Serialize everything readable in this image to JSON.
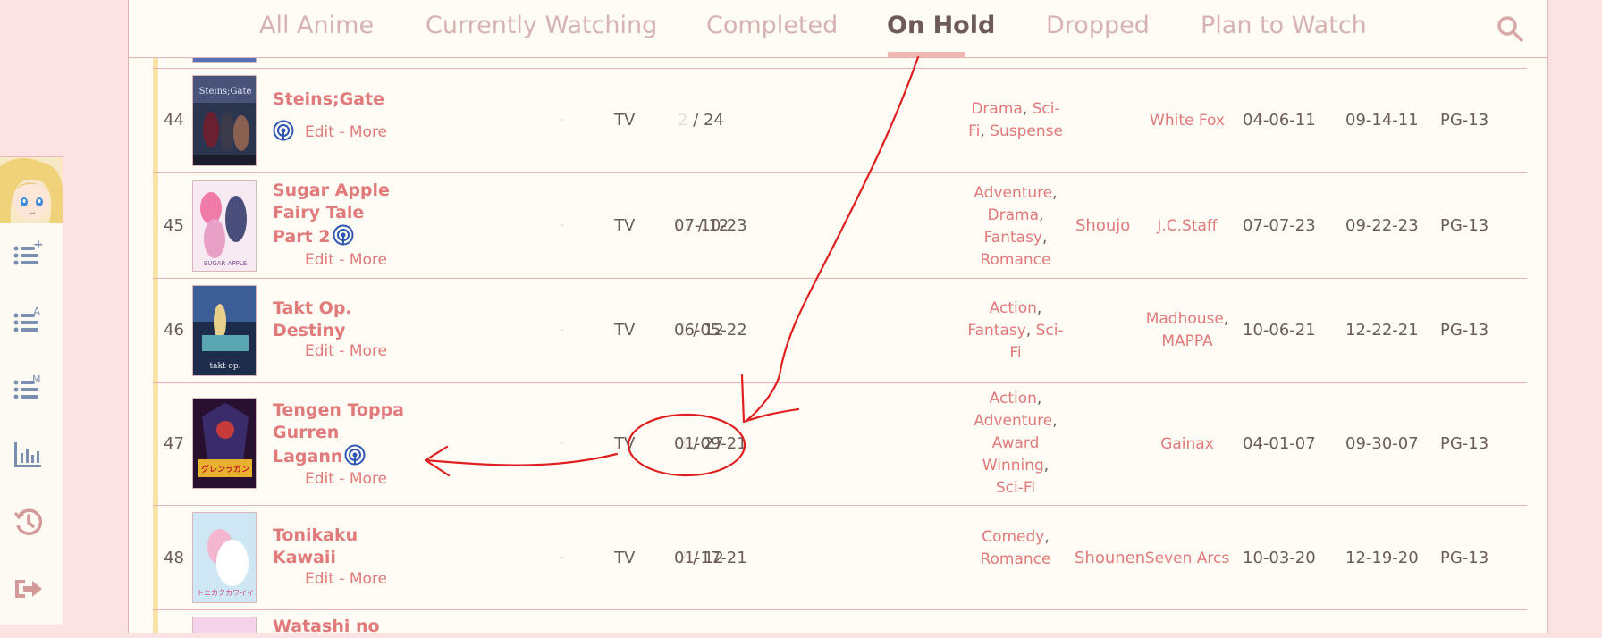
{
  "tabs": [
    {
      "label": "All Anime",
      "active": false
    },
    {
      "label": "Currently Watching",
      "active": false
    },
    {
      "label": "Completed",
      "active": false
    },
    {
      "label": "On Hold",
      "active": true
    },
    {
      "label": "Dropped",
      "active": false
    },
    {
      "label": "Plan to Watch",
      "active": false
    }
  ],
  "sidebar": {
    "icons": [
      "add-list-icon",
      "list-alpha-icon",
      "list-manga-icon",
      "stats-icon",
      "history-icon",
      "logout-icon"
    ],
    "superscripts": [
      "+",
      "A",
      "M"
    ]
  },
  "edit_more": {
    "edit": "Edit",
    "sep": "-",
    "more": "More"
  },
  "rows": [
    {
      "num": "44",
      "title": "Steins;Gate",
      "score": "-",
      "type": "TV",
      "watched": "2",
      "total": "/ 24",
      "start_date": "",
      "genres": [
        "Drama",
        "Sci-Fi",
        "Suspense"
      ],
      "demographic": "",
      "studios": [
        "White Fox"
      ],
      "aired_start": "04-06-11",
      "aired_end": "09-14-11",
      "rating": "PG-13"
    },
    {
      "num": "45",
      "title": "Sugar Apple Fairy Tale Part 2",
      "score": "-",
      "type": "TV",
      "watched": "11",
      "total": "/ 12",
      "start_date": "07-10-23",
      "genres": [
        "Adventure",
        "Drama",
        "Fantasy",
        "Romance"
      ],
      "demographic": "Shoujo",
      "studios": [
        "J.C.Staff"
      ],
      "aired_start": "07-07-23",
      "aired_end": "09-22-23",
      "rating": "PG-13"
    },
    {
      "num": "46",
      "title": "Takt Op. Destiny",
      "score": "-",
      "type": "TV",
      "watched": "1",
      "total": "/ 12",
      "start_date": "06-05-22",
      "genres": [
        "Action",
        "Fantasy",
        "Sci-Fi"
      ],
      "demographic": "",
      "studios": [
        "Madhouse",
        "MAPPA"
      ],
      "aired_start": "10-06-21",
      "aired_end": "12-22-21",
      "rating": "PG-13"
    },
    {
      "num": "47",
      "title": "Tengen Toppa Gurren Lagann",
      "score": "-",
      "type": "TV",
      "watched": "3",
      "total": "/ 27",
      "start_date": "01-09-21",
      "genres": [
        "Action",
        "Adventure",
        "Award Winning",
        "Sci-Fi"
      ],
      "demographic": "",
      "studios": [
        "Gainax"
      ],
      "aired_start": "04-01-07",
      "aired_end": "09-30-07",
      "rating": "PG-13"
    },
    {
      "num": "48",
      "title": "Tonikaku Kawaii",
      "score": "-",
      "type": "TV",
      "watched": "2",
      "total": "/ 12",
      "start_date": "01-17-21",
      "genres": [
        "Comedy",
        "Romance"
      ],
      "demographic": "Shounen",
      "studios": [
        "Seven Arcs"
      ],
      "aired_start": "10-03-20",
      "aired_end": "12-19-20",
      "rating": "PG-13"
    },
    {
      "num": "",
      "title": "Watashi no",
      "score": "",
      "type": "",
      "watched": "",
      "total": "",
      "start_date": "",
      "genres": [],
      "demographic": "",
      "studios": [],
      "aired_start": "",
      "aired_end": "",
      "rating": ""
    }
  ],
  "colors": {
    "accent": "#e17a7a",
    "annotation": "#e02020",
    "active_tab_underline": "#f2b8b4",
    "status_stripe": "#f9e3a8",
    "page_bg": "#fbe3e3",
    "panel_bg": "#fffcf5"
  }
}
